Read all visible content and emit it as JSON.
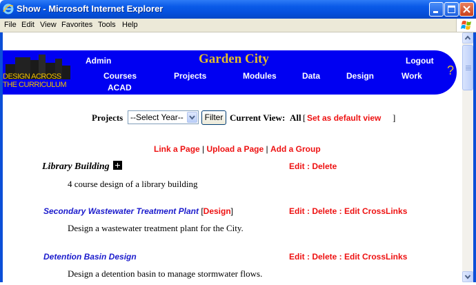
{
  "window": {
    "title": "Show - Microsoft Internet Explorer"
  },
  "menu": [
    "File",
    "Edit",
    "View",
    "Favorites",
    "Tools",
    "Help"
  ],
  "banner": {
    "logo_line1": "DESIGN ACROSS",
    "logo_line2": "THE CURRICULUM",
    "title": "Garden City",
    "nav": {
      "admin": "Admin",
      "courses": "Courses",
      "acad": "ACAD",
      "projects": "Projects",
      "modules": "Modules",
      "data": "Data",
      "design": "Design",
      "logout": "Logout",
      "work": "Work",
      "help": "?"
    }
  },
  "filter": {
    "label": "Projects",
    "select_value": "--Select Year--",
    "button": "Filter",
    "current_view_label": "Current View:",
    "current_view_value": "All",
    "bracket_open": "[",
    "set_default": "Set as default view",
    "bracket_close": "]"
  },
  "actions": {
    "link_page": "Link a Page",
    "sep1": " | ",
    "upload_page": "Upload a Page",
    "sep2": " | ",
    "add_group": "Add a Group"
  },
  "projects": [
    {
      "title": "Library Building",
      "design_label": "",
      "actions": "Edit : Delete",
      "description": "4 course design of a library building"
    },
    {
      "title": "Secondary Wastewater Treatment Plant",
      "design_label": "Design",
      "actions": "Edit : Delete : Edit CrossLinks",
      "description": "Design a wastewater treatment plant for the City."
    },
    {
      "title": "Detention Basin Design",
      "design_label": "",
      "actions": "Edit : Delete : Edit CrossLinks",
      "description": "Design a detention basin to manage stormwater flows."
    }
  ],
  "colors": {
    "banner_blue": "#0000f2",
    "title_gold": "#e4be2a",
    "link_red": "#ee1111",
    "project_link_blue": "#1a1acc",
    "xp_titlebar": "#0550dc"
  },
  "icons": [
    "ie-icon",
    "minimize-icon",
    "maximize-icon",
    "close-icon",
    "windows-logo-icon",
    "plus-box-icon",
    "scroll-up-icon",
    "scroll-down-icon"
  ]
}
